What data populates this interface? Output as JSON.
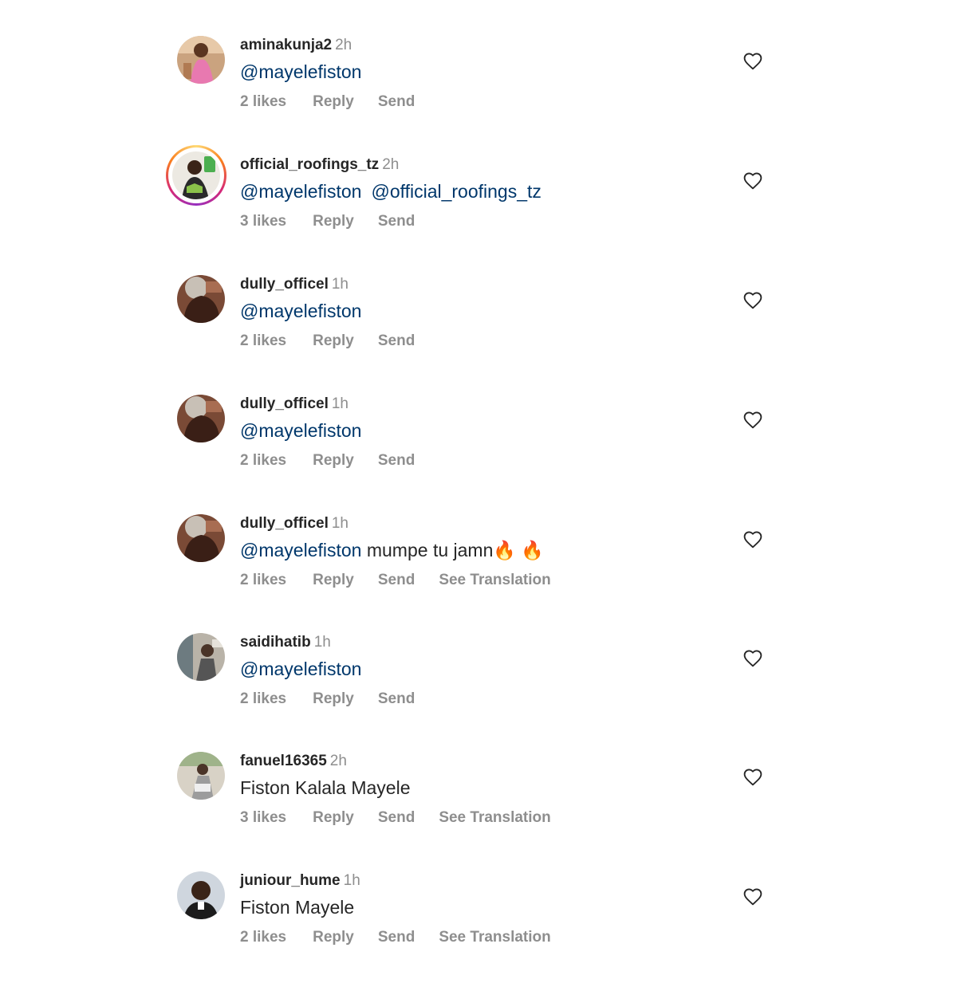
{
  "colors": {
    "username": "#262626",
    "mention": "#00376b",
    "meta_gray": "#8e8e8e",
    "background": "#ffffff"
  },
  "comments": [
    {
      "username": "aminakunja2",
      "time": "2h",
      "mentions": [
        "@mayelefiston"
      ],
      "text": "",
      "likes": "2 likes",
      "reply": "Reply",
      "send": "Send",
      "translation": "",
      "story_ring": false,
      "avatar_icon": "avatar-photo"
    },
    {
      "username": "official_roofings_tz",
      "time": "2h",
      "mentions": [
        "@mayelefiston",
        "@official_roofings_tz"
      ],
      "text": "",
      "likes": "3 likes",
      "reply": "Reply",
      "send": "Send",
      "translation": "",
      "story_ring": true,
      "avatar_icon": "avatar-photo"
    },
    {
      "username": "dully_officel",
      "time": "1h",
      "mentions": [
        "@mayelefiston"
      ],
      "text": "",
      "likes": "2 likes",
      "reply": "Reply",
      "send": "Send",
      "translation": "",
      "story_ring": false,
      "avatar_icon": "avatar-photo"
    },
    {
      "username": "dully_officel",
      "time": "1h",
      "mentions": [
        "@mayelefiston"
      ],
      "text": "",
      "likes": "2 likes",
      "reply": "Reply",
      "send": "Send",
      "translation": "",
      "story_ring": false,
      "avatar_icon": "avatar-photo"
    },
    {
      "username": "dully_officel",
      "time": "1h",
      "mentions": [
        "@mayelefiston"
      ],
      "text": "mumpe tu jamn🔥 🔥",
      "likes": "2 likes",
      "reply": "Reply",
      "send": "Send",
      "translation": "See Translation",
      "story_ring": false,
      "avatar_icon": "avatar-photo"
    },
    {
      "username": "saidihatib",
      "time": "1h",
      "mentions": [
        "@mayelefiston"
      ],
      "text": "",
      "likes": "2 likes",
      "reply": "Reply",
      "send": "Send",
      "translation": "",
      "story_ring": false,
      "avatar_icon": "avatar-photo"
    },
    {
      "username": "fanuel16365",
      "time": "2h",
      "mentions": [],
      "text": "Fiston Kalala Mayele",
      "likes": "3 likes",
      "reply": "Reply",
      "send": "Send",
      "translation": "See Translation",
      "story_ring": false,
      "avatar_icon": "avatar-photo"
    },
    {
      "username": "juniour_hume",
      "time": "1h",
      "mentions": [],
      "text": "Fiston Mayele",
      "likes": "2 likes",
      "reply": "Reply",
      "send": "Send",
      "translation": "See Translation",
      "story_ring": false,
      "avatar_icon": "avatar-photo"
    }
  ],
  "like_icon": "heart-outline-icon"
}
